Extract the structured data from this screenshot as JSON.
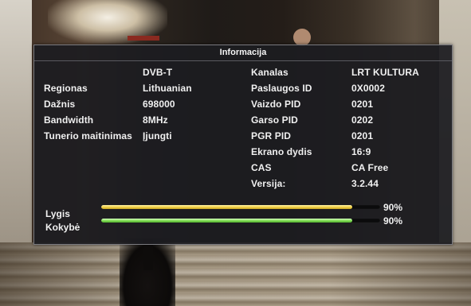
{
  "panel": {
    "title": "Informacija"
  },
  "left_block": {
    "system": "DVB-T",
    "rows": [
      {
        "label": "Regionas",
        "value": "Lithuanian"
      },
      {
        "label": "Dažnis",
        "value": "698000"
      },
      {
        "label": "Bandwidth",
        "value": "8MHz"
      },
      {
        "label": "Tunerio maitinimas",
        "value": "Įjungti"
      }
    ]
  },
  "right_block": {
    "rows": [
      {
        "label": "Kanalas",
        "value": "LRT KULTURA"
      },
      {
        "label": "Paslaugos ID",
        "value": "0X0002"
      },
      {
        "label": "Vaizdo PID",
        "value": "0201"
      },
      {
        "label": "Garso PID",
        "value": "0202"
      },
      {
        "label": "PGR PID",
        "value": "0201"
      },
      {
        "label": "Ekrano dydis",
        "value": "16:9"
      },
      {
        "label": "CAS",
        "value": "CA Free"
      },
      {
        "label": "Versija:",
        "value": "3.2.44"
      }
    ]
  },
  "signal": {
    "level": {
      "label": "Lygis",
      "percent_text": "90%",
      "value": 0.9
    },
    "quality": {
      "label": "Kokybė",
      "percent_text": "90%",
      "value": 0.9
    }
  },
  "colors": {
    "panel_bg": "#1c1c20",
    "level_bar": "#f3d44c",
    "quality_bar": "#86e05a",
    "text": "#f0f0f0"
  }
}
